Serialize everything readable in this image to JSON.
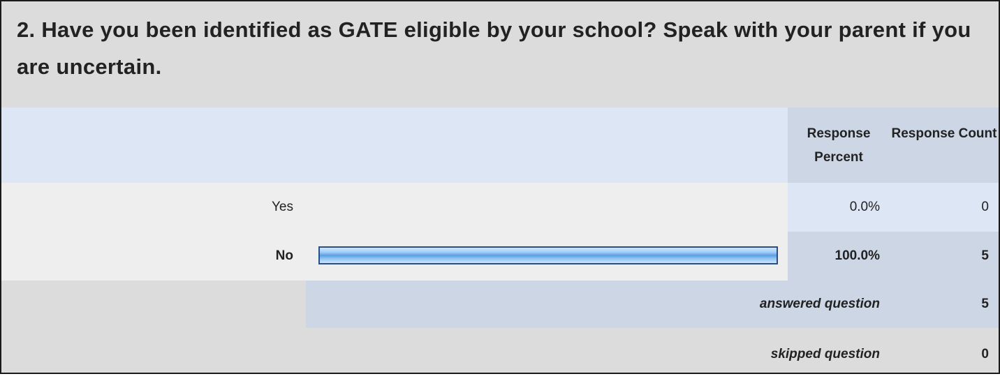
{
  "question": {
    "title": "2. Have you been identified as GATE eligible by your school? Speak with your parent if you are uncertain."
  },
  "table": {
    "headers": {
      "percent": "Response Percent",
      "count": "Response Count"
    },
    "rows": [
      {
        "label": "Yes",
        "percent": "0.0%",
        "count": "0",
        "fraction": 0.0
      },
      {
        "label": "No",
        "percent": "100.0%",
        "count": "5",
        "fraction": 1.0
      }
    ],
    "answered": {
      "label": "answered question",
      "value": "5"
    },
    "skipped": {
      "label": "skipped question",
      "value": "0"
    }
  },
  "colors": {
    "bar_border": "#2a4f86",
    "bar_fill": "#5a9fe3",
    "header_bg": "#dce6f4",
    "accent_col_bg": "#ccd6e4"
  }
}
